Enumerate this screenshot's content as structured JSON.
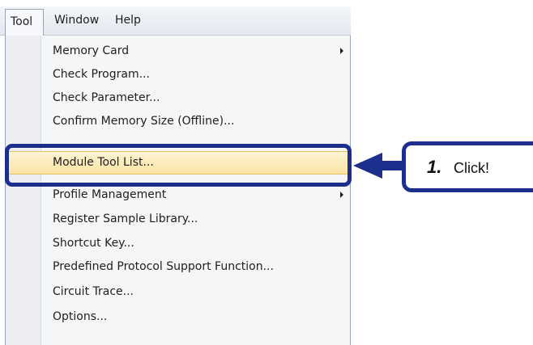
{
  "menubar": {
    "items": [
      "Tool",
      "Window",
      "Help"
    ],
    "active_item": "Tool"
  },
  "dropdown": {
    "items": [
      {
        "label": "Memory Card",
        "has_submenu": true
      },
      {
        "label": "Check Program...",
        "has_submenu": false
      },
      {
        "label": "Check Parameter...",
        "has_submenu": false
      },
      {
        "label": "Confirm Memory Size (Offline)...",
        "has_submenu": false
      },
      {
        "label": "Module Tool List...",
        "has_submenu": false,
        "highlighted": true
      },
      {
        "label": "Profile Management",
        "has_submenu": true
      },
      {
        "label": "Register Sample Library...",
        "has_submenu": false
      },
      {
        "label": "Shortcut Key...",
        "has_submenu": false
      },
      {
        "label": "Predefined Protocol Support Function...",
        "has_submenu": false
      },
      {
        "label": "Circuit Trace...",
        "has_submenu": false
      },
      {
        "label": "Options...",
        "has_submenu": false
      }
    ]
  },
  "callout": {
    "step_number": "1.",
    "text": "Click!",
    "color": "#1d2f8c"
  },
  "colors": {
    "highlight_fill": "#fbe3a1",
    "menu_background": "#f5f6f8",
    "annotation_blue": "#1d2f8c"
  }
}
